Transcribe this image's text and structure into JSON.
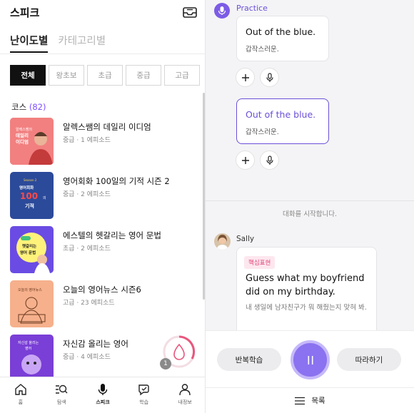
{
  "left": {
    "title": "스피크",
    "tabs": [
      {
        "label": "난이도별",
        "active": true
      },
      {
        "label": "카테고리별",
        "active": false
      }
    ],
    "levels": [
      "전체",
      "왕초보",
      "초급",
      "중급",
      "고급"
    ],
    "selected_level": "전체",
    "course_header": {
      "label": "코스",
      "count": "(82)"
    },
    "courses": [
      {
        "title": "알렉스쌤의 데일리 이디엄",
        "meta": "중급 · 1 에피소드",
        "thumb_text": "데일리\n이디엄",
        "thumb_color": "#f26a6a"
      },
      {
        "title": "영어회화 100일의 기적 시즌 2",
        "meta": "중급 · 2 에피소드",
        "thumb_text": "100일의 기적",
        "thumb_color": "#2f4e9c"
      },
      {
        "title": "에스텔의 헷갈리는 영어 문법",
        "meta": "초급 · 2 에피소드",
        "thumb_text": "헷갈리는 영어 문법",
        "thumb_color": "#6b4de6"
      },
      {
        "title": "오늘의 영어뉴스 시즌6",
        "meta": "고급 · 23 에피소드",
        "thumb_text": "오늘의 영어뉴스",
        "thumb_color": "#f2a07a"
      },
      {
        "title": "자신감 올리는 영어",
        "meta": "중급 · 4 에피소드",
        "thumb_text": "자신감 올리는 영어",
        "thumb_color": "#7a3fd6"
      }
    ],
    "badge_count": "1",
    "nav": [
      {
        "label": "홈",
        "icon": "home-icon"
      },
      {
        "label": "탐색",
        "icon": "search-icon"
      },
      {
        "label": "스피크",
        "icon": "mic-icon"
      },
      {
        "label": "학습",
        "icon": "study-icon"
      },
      {
        "label": "내정보",
        "icon": "profile-icon"
      }
    ]
  },
  "right": {
    "practice_label": "Practice",
    "cards": [
      {
        "en": "Out of the blue.",
        "ko": "갑작스러운.",
        "highlighted": false
      },
      {
        "en": "Out of the blue.",
        "ko": "갑작스러운.",
        "highlighted": true
      }
    ],
    "start_text": "대화를 시작합니다.",
    "sally": {
      "name": "Sally",
      "tag": "핵심표현",
      "en": "Guess what my boyfriend did on my birthday.",
      "ko": "내 생일에 남자친구가 뭐 해줬는지 맞혀 봐."
    },
    "controls": {
      "repeat_label": "반복학습",
      "follow_label": "따라하기"
    },
    "list_label": "목록",
    "accent": "#6b4fd8"
  }
}
